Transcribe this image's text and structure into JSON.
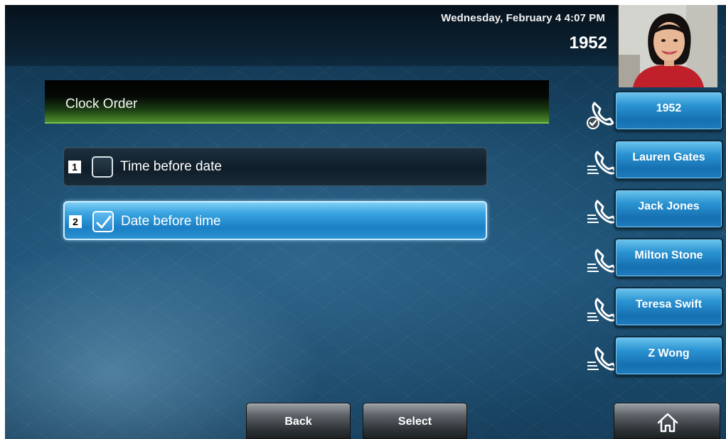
{
  "status_bar": {
    "datetime": "Wednesday, February 4  4:07 PM",
    "line_number": "1952"
  },
  "screen": {
    "title": "Clock Order",
    "options": [
      {
        "index": "1",
        "label": "Time before date",
        "checked": false
      },
      {
        "index": "2",
        "label": "Date before time",
        "checked": true
      }
    ]
  },
  "line_keys": [
    {
      "label": "1952",
      "icon": "phone-registered-icon"
    },
    {
      "label": "Lauren Gates",
      "icon": "phone-idle-icon"
    },
    {
      "label": "Jack Jones",
      "icon": "phone-idle-icon"
    },
    {
      "label": "Milton Stone",
      "icon": "phone-idle-icon"
    },
    {
      "label": "Teresa Swift",
      "icon": "phone-idle-icon"
    },
    {
      "label": "Z Wong",
      "icon": "phone-idle-icon"
    }
  ],
  "softkeys": {
    "back": "Back",
    "select": "Select",
    "home_icon": "home-icon"
  },
  "colors": {
    "selected_row": "#2c92d2",
    "title_accent": "#4d8d2c",
    "line_key": "#2a93d2",
    "softkey": "#5b6166"
  }
}
